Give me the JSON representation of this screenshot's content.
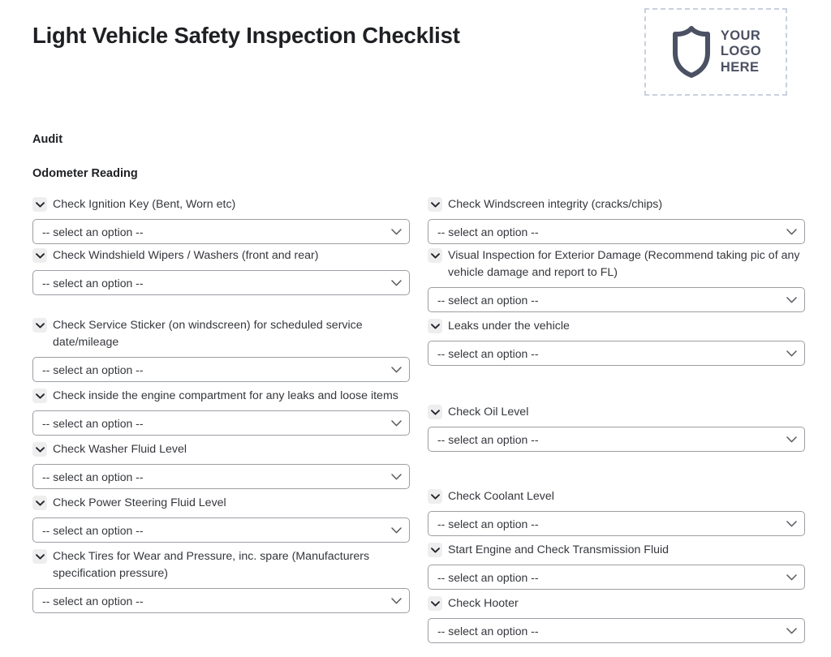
{
  "document": {
    "title": "Light Vehicle Safety Inspection Checklist"
  },
  "logo": {
    "icon": "shield-icon",
    "line1": "YOUR",
    "line2": "LOGO",
    "line3": "HERE",
    "color": "#4b5163",
    "border_color": "#c9d0dd"
  },
  "sections": {
    "audit_heading": "Audit",
    "odometer_heading": "Odometer Reading"
  },
  "select_placeholder": "-- select an option --",
  "columns": {
    "left": [
      {
        "label": "Check Ignition Key (Bent, Worn etc)",
        "value": "-- select an option --",
        "gap_before": 0
      },
      {
        "label": "Check Windshield Wipers / Washers (front and rear)",
        "value": "-- select an option --",
        "gap_before": 0
      },
      {
        "label": "Check Service Sticker (on windscreen) for scheduled service date/mileage",
        "value": "-- select an option --",
        "gap_before": 23
      },
      {
        "label": "Check inside the engine compartment for any leaks and loose items",
        "value": "-- select an option --",
        "gap_before": 3
      },
      {
        "label": "Check Washer Fluid Level",
        "value": "-- select an option --",
        "gap_before": 3
      },
      {
        "label": "Check Power Steering Fluid Level",
        "value": "-- select an option --",
        "gap_before": 3
      },
      {
        "label": "Check Tires for Wear and Pressure, inc. spare (Manufacturers specification pressure)",
        "value": "-- select an option --",
        "gap_before": 3
      }
    ],
    "right": [
      {
        "label": "Check Windscreen integrity (cracks/chips)",
        "value": "-- select an option --",
        "gap_before": 0
      },
      {
        "label": "Visual Inspection for Exterior Damage (Recommend taking pic of any vehicle damage and report to FL)",
        "value": "-- select an option --",
        "gap_before": 0
      },
      {
        "label": "Leaks under the vehicle",
        "value": "-- select an option --",
        "gap_before": 3
      },
      {
        "label": "Check Oil Level",
        "value": "-- select an option --",
        "gap_before": 43
      },
      {
        "label": "Check Coolant Level",
        "value": "-- select an option --",
        "gap_before": 41
      },
      {
        "label": "Start Engine and Check Transmission Fluid",
        "value": "-- select an option --",
        "gap_before": 3
      },
      {
        "label": "Check Hooter",
        "value": "-- select an option --",
        "gap_before": 3
      }
    ]
  }
}
